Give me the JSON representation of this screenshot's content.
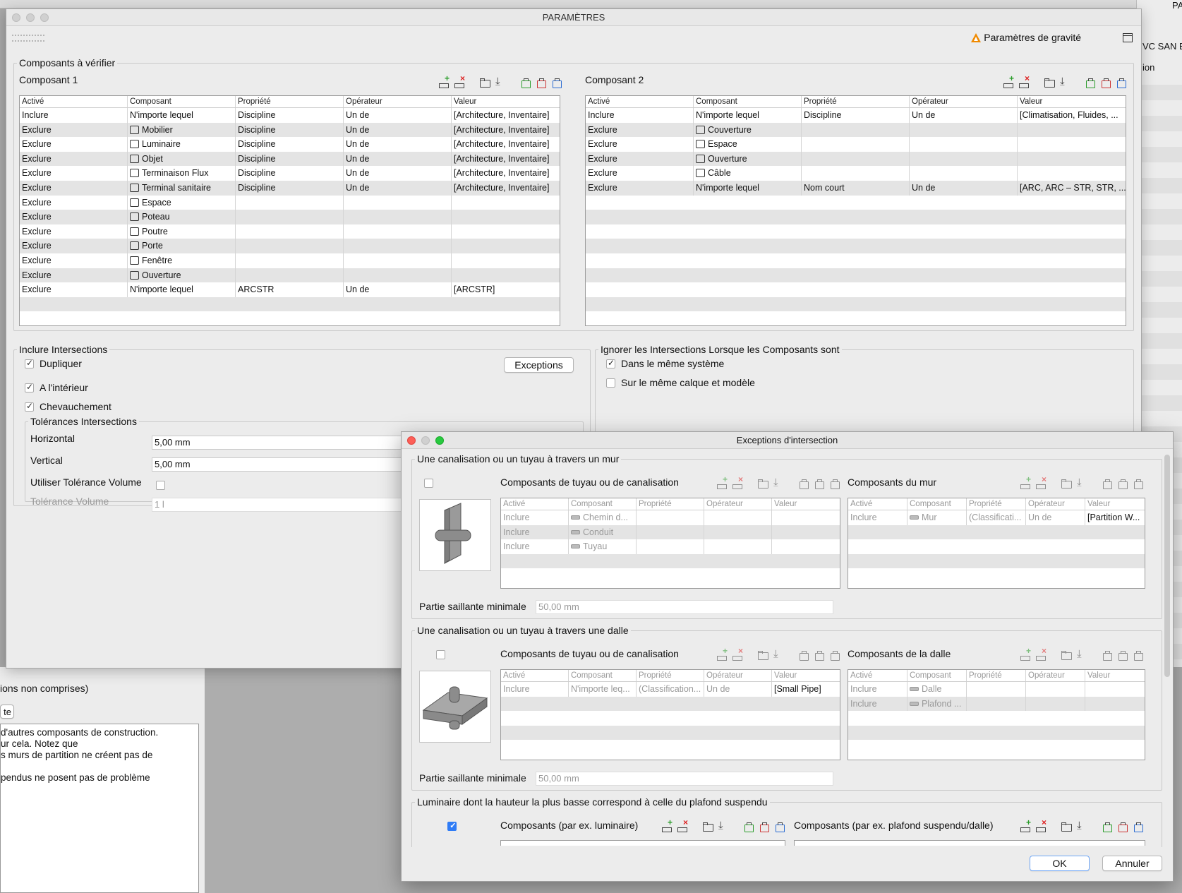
{
  "background": {
    "right_label_1": "VC SAN E",
    "right_label_2": "ion",
    "top_right_label": "PA",
    "left_text_1": "ions non comprises)",
    "left_button": "te",
    "left_paragraph": [
      "d'autres composants de construction.",
      "ur cela. Notez que",
      "s murs de partition ne créent pas de",
      "",
      "pendus ne posent pas de problème"
    ]
  },
  "params": {
    "title": "PARAMÈTRES",
    "gravity_label": "Paramètres de gravité",
    "components_group": "Composants à vérifier",
    "comp1_label": "Composant 1",
    "comp2_label": "Composant 2",
    "columns": [
      "Activé",
      "Composant",
      "Propriété",
      "Opérateur",
      "Valeur"
    ],
    "comp1_rows": [
      {
        "active": "Inclure",
        "icon": "",
        "component": "N'importe lequel",
        "property": "Discipline",
        "operator": "Un de",
        "value": "[Architecture, Inventaire]"
      },
      {
        "active": "Exclure",
        "icon": "furniture-icon",
        "component": "Mobilier",
        "property": "Discipline",
        "operator": "Un de",
        "value": "[Architecture, Inventaire]"
      },
      {
        "active": "Exclure",
        "icon": "lamp-icon",
        "component": "Luminaire",
        "property": "Discipline",
        "operator": "Un de",
        "value": "[Architecture, Inventaire]"
      },
      {
        "active": "Exclure",
        "icon": "object-icon",
        "component": "Objet",
        "property": "Discipline",
        "operator": "Un de",
        "value": "[Architecture, Inventaire]"
      },
      {
        "active": "Exclure",
        "icon": "flow-terminal-icon",
        "component": "Terminaison Flux",
        "property": "Discipline",
        "operator": "Un de",
        "value": "[Architecture, Inventaire]"
      },
      {
        "active": "Exclure",
        "icon": "sanitary-icon",
        "component": "Terminal sanitaire",
        "property": "Discipline",
        "operator": "Un de",
        "value": "[Architecture, Inventaire]"
      },
      {
        "active": "Exclure",
        "icon": "space-icon",
        "component": "Espace",
        "property": "",
        "operator": "",
        "value": ""
      },
      {
        "active": "Exclure",
        "icon": "column-icon",
        "component": "Poteau",
        "property": "",
        "operator": "",
        "value": ""
      },
      {
        "active": "Exclure",
        "icon": "beam-icon",
        "component": "Poutre",
        "property": "",
        "operator": "",
        "value": ""
      },
      {
        "active": "Exclure",
        "icon": "door-icon",
        "component": "Porte",
        "property": "",
        "operator": "",
        "value": ""
      },
      {
        "active": "Exclure",
        "icon": "window-icon",
        "component": "Fenêtre",
        "property": "",
        "operator": "",
        "value": ""
      },
      {
        "active": "Exclure",
        "icon": "opening-icon",
        "component": "Ouverture",
        "property": "",
        "operator": "",
        "value": ""
      },
      {
        "active": "Exclure",
        "icon": "",
        "component": "N'importe lequel",
        "property": "ARCSTR",
        "operator": "Un de",
        "value": "[ARCSTR]"
      }
    ],
    "comp2_rows": [
      {
        "active": "Inclure",
        "icon": "",
        "component": "N'importe lequel",
        "property": "Discipline",
        "operator": "Un de",
        "value": "[Climatisation, Fluides, ..."
      },
      {
        "active": "Exclure",
        "icon": "roof-icon",
        "component": "Couverture",
        "property": "",
        "operator": "",
        "value": ""
      },
      {
        "active": "Exclure",
        "icon": "space-icon",
        "component": "Espace",
        "property": "",
        "operator": "",
        "value": ""
      },
      {
        "active": "Exclure",
        "icon": "opening-icon",
        "component": "Ouverture",
        "property": "",
        "operator": "",
        "value": ""
      },
      {
        "active": "Exclure",
        "icon": "cable-icon",
        "component": "Câble",
        "property": "",
        "operator": "",
        "value": ""
      },
      {
        "active": "Exclure",
        "icon": "",
        "component": "N'importe lequel",
        "property": "Nom court",
        "operator": "Un de",
        "value": "[ARC, ARC – STR, STR, ..."
      }
    ],
    "include_group": "Inclure Intersections",
    "dup_label": "Dupliquer",
    "exceptions_button": "Exceptions",
    "inside_label": "A l'intérieur",
    "overlap_label": "Chevauchement",
    "tol_group": "Tolérances Intersections",
    "horizontal_label": "Horizontal",
    "horizontal_value": "5,00 mm",
    "vertical_label": "Vertical",
    "vertical_value": "5,00 mm",
    "use_vol_label": "Utiliser Tolérance Volume",
    "vol_label": "Tolérance Volume",
    "vol_value": "1 l",
    "ignore_group": "Ignorer les Intersections Lorsque les Composants sont",
    "same_system_label": "Dans le même système",
    "same_layer_label": "Sur le même calque et modèle"
  },
  "exceptions": {
    "title": "Exceptions d'intersection",
    "group1": {
      "title": "Une canalisation ou un tuyau à travers un mur",
      "left_label": "Composants de tuyau ou de canalisation",
      "right_label": "Composants du mur",
      "left_rows": [
        {
          "active": "Inclure",
          "component": "Chemin d...",
          "property": "",
          "operator": "",
          "value": ""
        },
        {
          "active": "Inclure",
          "component": "Conduit",
          "property": "",
          "operator": "",
          "value": ""
        },
        {
          "active": "Inclure",
          "component": "Tuyau",
          "property": "",
          "operator": "",
          "value": ""
        }
      ],
      "right_rows": [
        {
          "active": "Inclure",
          "component": "Mur",
          "property": "(Classificati...",
          "operator": "Un de",
          "value": "[Partition W..."
        }
      ],
      "min_label": "Partie saillante minimale",
      "min_value": "50,00 mm"
    },
    "group2": {
      "title": "Une canalisation ou un tuyau à travers une dalle",
      "left_label": "Composants de tuyau ou de canalisation",
      "right_label": "Composants de la dalle",
      "left_rows": [
        {
          "active": "Inclure",
          "component": "N'importe leq...",
          "property": "(Classification...",
          "operator": "Un de",
          "value": "[Small Pipe]"
        }
      ],
      "right_rows": [
        {
          "active": "Inclure",
          "component": "Dalle",
          "property": "",
          "operator": "",
          "value": ""
        },
        {
          "active": "Inclure",
          "component": "Plafond ...",
          "property": "",
          "operator": "",
          "value": ""
        }
      ],
      "min_label": "Partie saillante minimale",
      "min_value": "50,00 mm"
    },
    "group3": {
      "title": "Luminaire dont la hauteur la plus basse correspond à celle du plafond suspendu",
      "left_label": "Composants (par ex. luminaire)",
      "right_label": "Composants (par ex. plafond suspendu/dalle)"
    },
    "ok": "OK",
    "cancel": "Annuler"
  }
}
